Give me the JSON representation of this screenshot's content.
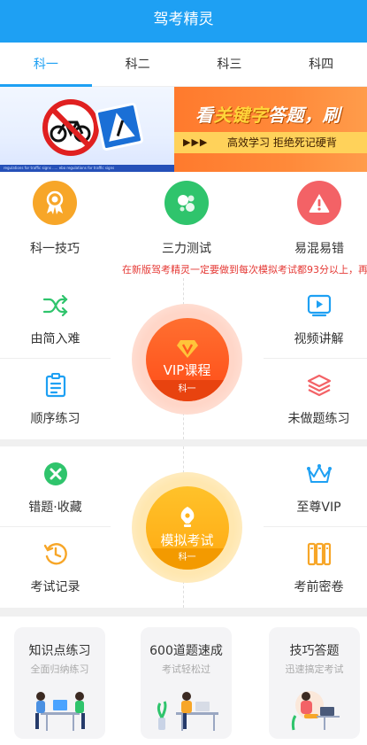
{
  "header": {
    "title": "驾考精灵"
  },
  "tabs": [
    {
      "label": "科一",
      "active": true
    },
    {
      "label": "科二",
      "active": false
    },
    {
      "label": "科三",
      "active": false
    },
    {
      "label": "科四",
      "active": false
    }
  ],
  "banner_a": {
    "strip_text": "regulations for traffic signs ..... ebo regulations for traffic signs"
  },
  "banner_b": {
    "headline_pre": "看",
    "headline_highlight": "关键字",
    "headline_post": "答题，刷",
    "arrows": "▶▶▶",
    "subtitle": "高效学习 拒绝死记硬背"
  },
  "quick": [
    {
      "label": "科一技巧",
      "icon": "award-ribbon-icon",
      "color": "#f7a628"
    },
    {
      "label": "三力测试",
      "icon": "molecule-icon",
      "color": "#2fc46c"
    },
    {
      "label": "易混易错",
      "icon": "warning-icon",
      "color": "#f36266"
    }
  ],
  "notice": "在新版驾考精灵一定要做到每次模拟考试都93分以上，再",
  "section1": {
    "top_left": {
      "label": "由简入难",
      "icon": "shuffle-icon"
    },
    "top_right": {
      "label": "视频讲解",
      "icon": "video-play-icon"
    },
    "bottom_left": {
      "label": "顺序练习",
      "icon": "clipboard-list-icon"
    },
    "bottom_right": {
      "label": "未做题练习",
      "icon": "layers-icon"
    },
    "center": {
      "title": "VIP课程",
      "sub": "科一",
      "icon": "vip-diamond-icon"
    }
  },
  "section2": {
    "top_left": {
      "label": "错题·收藏",
      "icon": "close-circle-icon"
    },
    "top_right": {
      "label": "至尊VIP",
      "icon": "crown-icon"
    },
    "bottom_left": {
      "label": "考试记录",
      "icon": "history-icon"
    },
    "bottom_right": {
      "label": "考前密卷",
      "icon": "book-stack-icon"
    },
    "center": {
      "title": "模拟考试",
      "sub": "科一",
      "icon": "pen-nib-icon"
    }
  },
  "cards": [
    {
      "title": "知识点练习",
      "sub": "全面归纳练习",
      "icon": "two-people-desk-illustration"
    },
    {
      "title": "600道题速成",
      "sub": "考试轻松过",
      "icon": "person-at-desk-illustration"
    },
    {
      "title": "技巧答题",
      "sub": "迅速搞定考试",
      "icon": "person-laptop-illustration"
    }
  ],
  "colors": {
    "primary": "#1ea0f3",
    "vip_orange": "#ff5a1f",
    "exam_yellow": "#ffbb14",
    "green": "#2fc46c",
    "notice_red": "#e53935"
  }
}
